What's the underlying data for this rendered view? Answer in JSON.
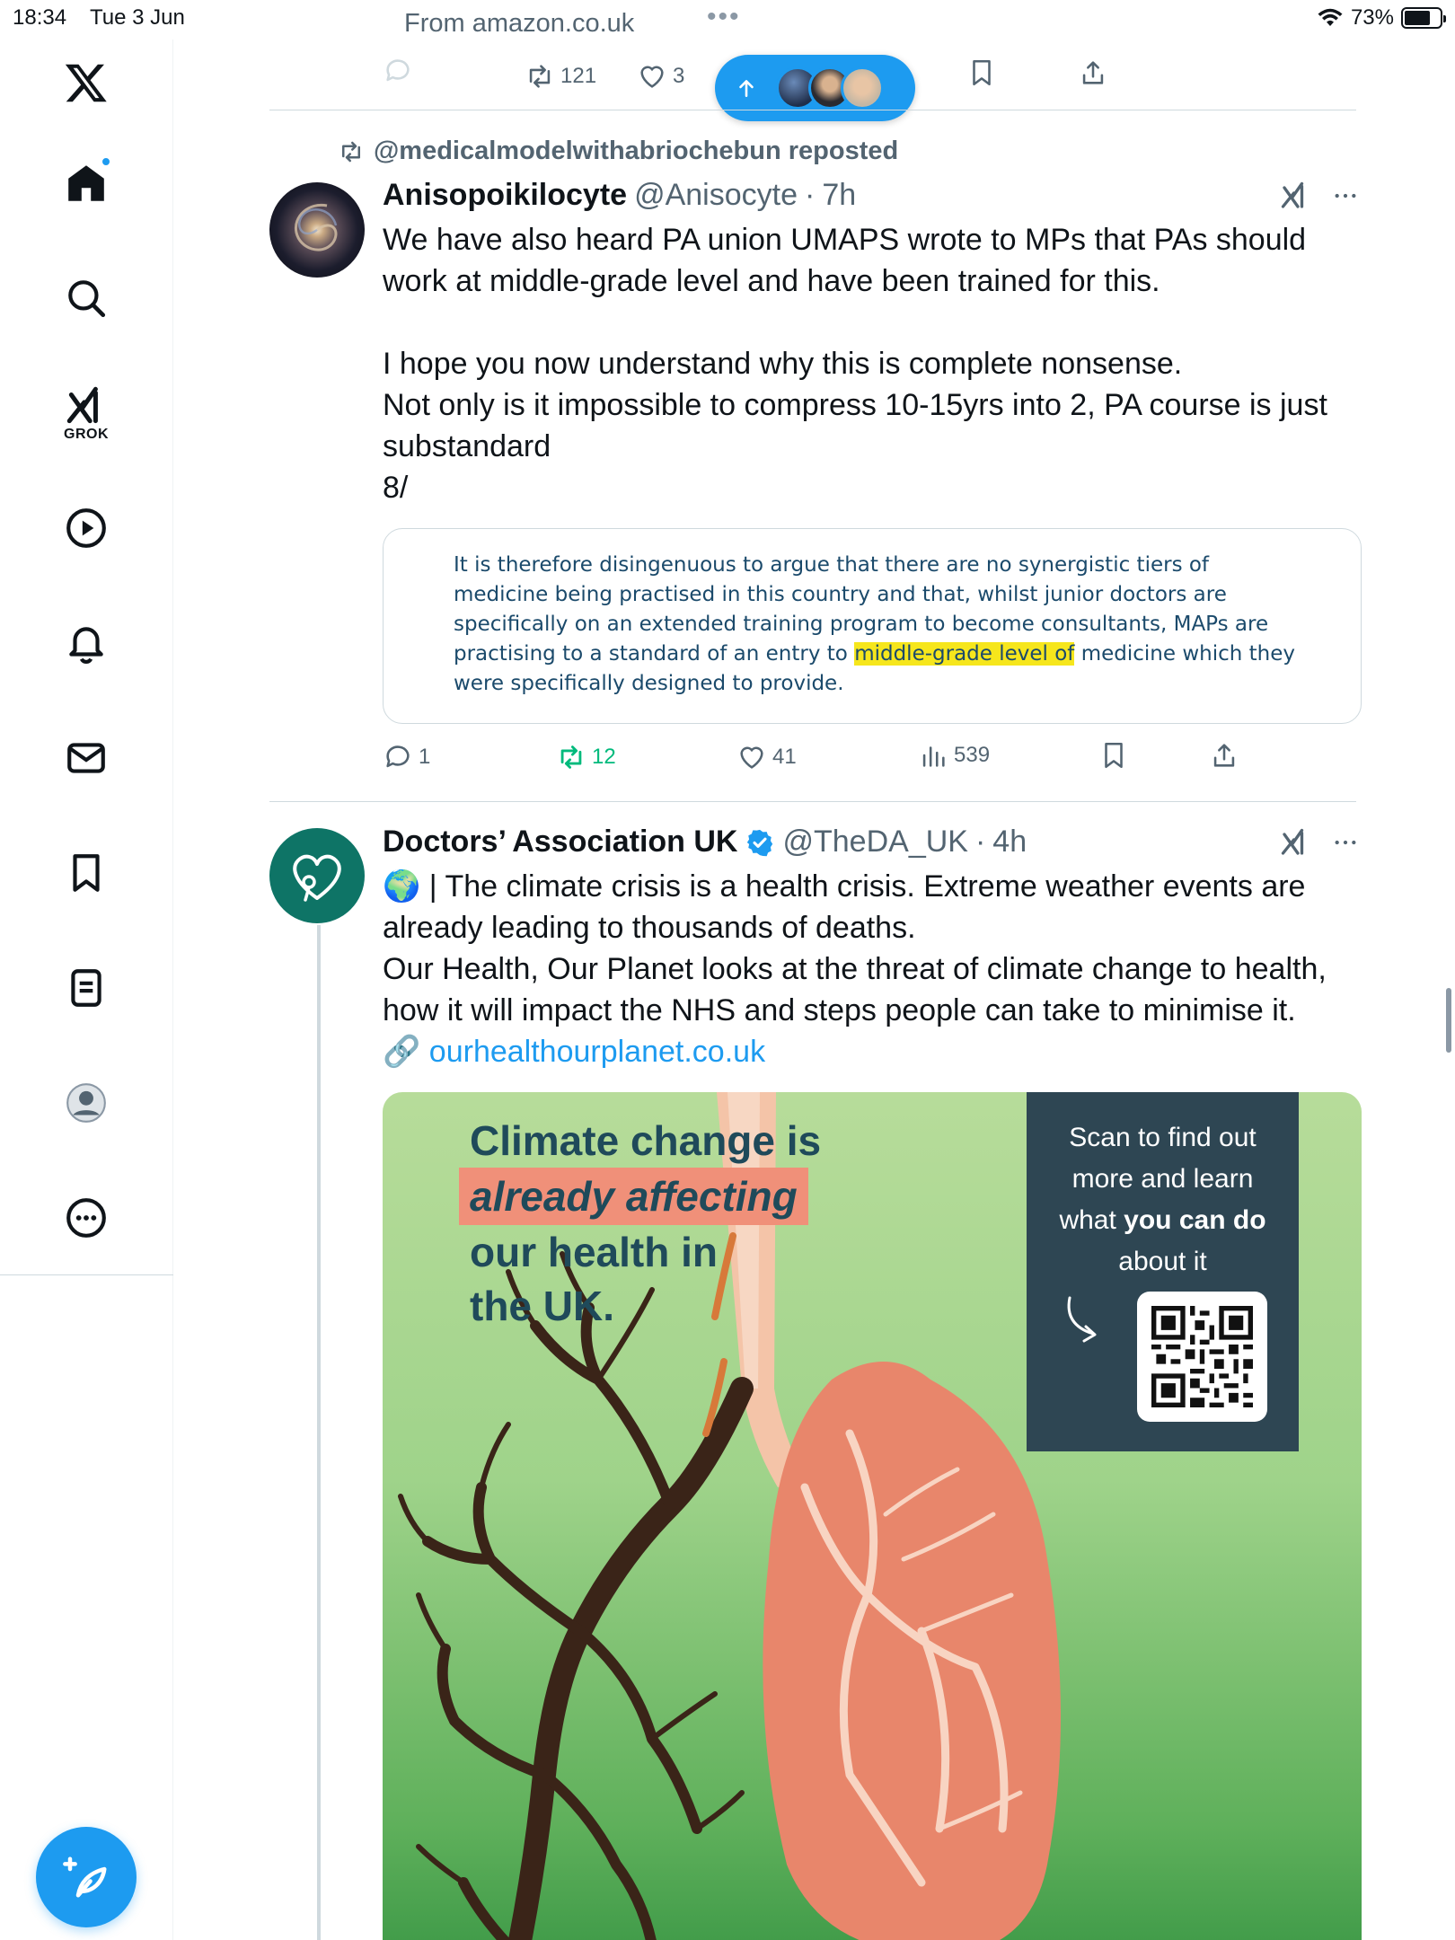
{
  "status_bar": {
    "time": "18:34",
    "date": "Tue 3 Jun",
    "source": "From amazon.co.uk",
    "dots": "•••",
    "battery": "73%",
    "battery_level": 0.73
  },
  "sidebar": {
    "grok_label": "GROK",
    "accent_color": "#1d9bf0"
  },
  "previous_tweet": {
    "retweets": "121",
    "likes_partial": "3"
  },
  "tweet1": {
    "reposted_by": "@medicalmodelwithabriochebun reposted",
    "name": "Anisopoikilocyte",
    "handle": "@Anisocyte",
    "sep": "·",
    "time": "7h",
    "text": "We have also heard PA union UMAPS wrote to MPs that PAs should work at middle-grade level and have been trained for this.\n\nI hope you now understand why this is complete nonsense.\nNot only is it impossible to compress 10-15yrs into 2, PA course is just substandard\n8/",
    "quote_before": "It is therefore disingenuous to argue that there are no synergistic tiers of medicine being practised in this country and that, whilst junior doctors are specifically on an extended training program to become consultants, MAPs are practising to a standard of an entry to ",
    "quote_highlight": "middle-grade level of",
    "quote_after": " medicine which they were specifically designed to provide.",
    "replies": "1",
    "retweets": "12",
    "likes": "41",
    "views": "539"
  },
  "tweet2": {
    "name": "Doctors’ Association UK",
    "handle": "@TheDA_UK",
    "sep": "·",
    "time": "4h",
    "text_line1": "🌍 | The climate crisis is a health crisis. Extreme weather events are already leading to thousands of deaths.",
    "text_line2": "Our Health, Our Planet looks at the threat of climate change to health, how it will impact the NHS and steps people can take to minimise it.",
    "link_emoji": "🔗",
    "link": "ourhealthourplanet.co.uk",
    "media": {
      "title_line1": "Climate change is",
      "title_accent": "already affecting",
      "title_line3": "our health in",
      "title_line4": "the UK.",
      "scan_line1": "Scan to find out",
      "scan_line2": "more and learn",
      "scan_line3_plain": "what ",
      "scan_line3_bold": "you can do",
      "scan_line4": "about it"
    }
  }
}
